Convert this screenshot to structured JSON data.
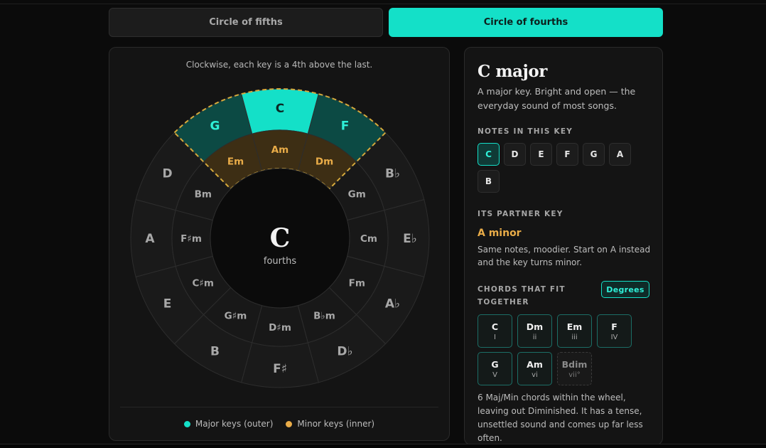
{
  "tabs": {
    "fifths": "Circle of fifths",
    "fourths": "Circle of fourths",
    "active": "fourths"
  },
  "wheel": {
    "caption": "Clockwise, each key is a 4th above the last.",
    "center_key": "C",
    "center_mode": "fourths",
    "major_keys": [
      "C",
      "F",
      "B♭",
      "E♭",
      "A♭",
      "D♭",
      "F♯",
      "B",
      "E",
      "A",
      "D",
      "G"
    ],
    "minor_keys": [
      "Am",
      "Dm",
      "Gm",
      "Cm",
      "Fm",
      "B♭m",
      "D♯m",
      "G♯m",
      "C♯m",
      "F♯m",
      "Bm",
      "Em"
    ],
    "highlight_major": [
      "G",
      "C",
      "F"
    ],
    "highlight_minor": [
      "Em",
      "Am",
      "Dm"
    ],
    "legend": [
      {
        "label": "Major keys (outer)",
        "color": "#14e0c8"
      },
      {
        "label": "Minor keys (inner)",
        "color": "#e9ac48"
      }
    ]
  },
  "info": {
    "title": "C major",
    "description": "A major key. Bright and open — the everyday sound of most songs.",
    "notes_label": "NOTES IN THIS KEY",
    "notes": [
      "C",
      "D",
      "E",
      "F",
      "G",
      "A",
      "B"
    ],
    "partner_label": "ITS PARTNER KEY",
    "partner_name": "A minor",
    "partner_desc": "Same notes, moodier. Start on A instead and the key turns minor.",
    "chords_label_1": "CHORDS THAT FIT",
    "chords_label_2": "TOGETHER",
    "degrees_button": "Degrees",
    "chords": [
      {
        "name": "C",
        "degree": "I"
      },
      {
        "name": "Dm",
        "degree": "ii"
      },
      {
        "name": "Em",
        "degree": "iii"
      },
      {
        "name": "F",
        "degree": "IV"
      },
      {
        "name": "G",
        "degree": "V"
      },
      {
        "name": "Am",
        "degree": "vi"
      },
      {
        "name": "Bdim",
        "degree": "vii°"
      }
    ],
    "chords_note": "6 Maj/Min chords within the wheel, leaving out Diminished. It has a tense, unsettled sound and comes up far less often."
  },
  "colors": {
    "accent": "#14e0c8",
    "minor_accent": "#e9ac48",
    "ring": "#1c1c1c",
    "border": "#303030"
  }
}
